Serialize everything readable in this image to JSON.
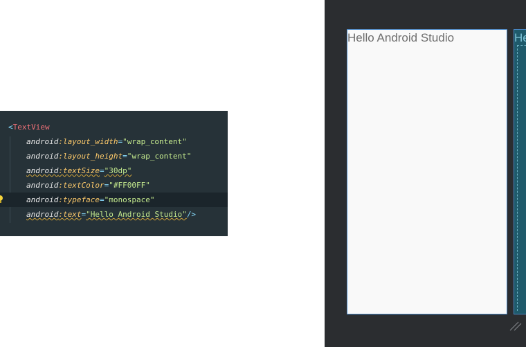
{
  "editor": {
    "lines": [
      {
        "parts": [
          {
            "t": "punct",
            "v": "<"
          },
          {
            "t": "tag",
            "v": "TextView"
          }
        ]
      },
      {
        "parts": [
          {
            "t": "ns",
            "v": "android"
          },
          {
            "t": "attr",
            "v": ":layout_width"
          },
          {
            "t": "punct",
            "v": "="
          },
          {
            "t": "str",
            "v": "\"wrap_content\""
          }
        ]
      },
      {
        "parts": [
          {
            "t": "ns",
            "v": "android"
          },
          {
            "t": "attr",
            "v": ":layout_height"
          },
          {
            "t": "punct",
            "v": "="
          },
          {
            "t": "str",
            "v": "\"wrap_content\""
          }
        ]
      },
      {
        "parts": [
          {
            "t": "ns",
            "v": "android"
          },
          {
            "t": "attr",
            "v": ":textSize"
          },
          {
            "t": "punct",
            "v": "="
          },
          {
            "t": "str",
            "v": "\"30dp\""
          }
        ],
        "squiggle": true
      },
      {
        "parts": [
          {
            "t": "ns",
            "v": "android"
          },
          {
            "t": "attr",
            "v": ":textColor"
          },
          {
            "t": "punct",
            "v": "="
          },
          {
            "t": "str",
            "v": "\"#FF00FF\""
          }
        ]
      },
      {
        "parts": [
          {
            "t": "ns",
            "v": "android"
          },
          {
            "t": "attr",
            "v": ":typeface"
          },
          {
            "t": "punct",
            "v": "="
          },
          {
            "t": "str",
            "v": "\"monospace\""
          }
        ],
        "current": true,
        "intention_bulb": true
      },
      {
        "parts": [
          {
            "t": "ns",
            "v": "android"
          },
          {
            "t": "attr",
            "v": ":text"
          },
          {
            "t": "punct",
            "v": "="
          },
          {
            "t": "str",
            "v": "\"Hello Android Studio\""
          },
          {
            "t": "punct",
            "v": "/>"
          }
        ],
        "squiggle": true
      }
    ],
    "bulb_icon": "lightbulb-icon",
    "colors": {
      "background": "#263238",
      "tag": "#f07178",
      "attr": "#ffcb6b",
      "string": "#c3e88d",
      "punct": "#89ddff"
    }
  },
  "preview": {
    "design_text": "Hello Android Studio",
    "blueprint_text": "He",
    "resize_icon": "resize-handle-icon",
    "colors": {
      "background": "#2b2d30",
      "design": "#f9f9f9",
      "blueprint": "#1f5a6b",
      "selection": "#4a88c7"
    }
  }
}
